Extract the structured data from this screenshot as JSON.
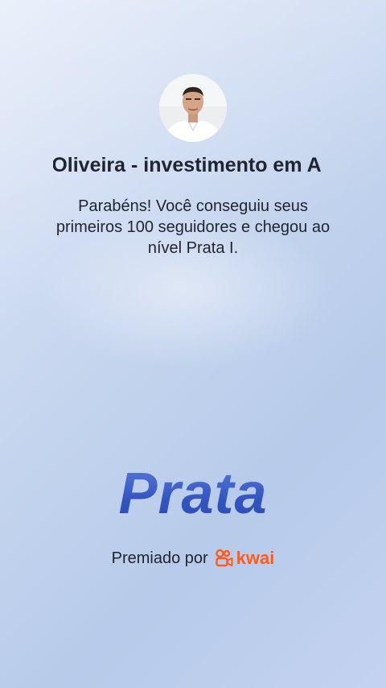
{
  "profile": {
    "name": "Oliveira - investimento em A",
    "avatar_icon": "profile-photo"
  },
  "message": "Parabéns! Você conseguiu seus primeiros 100 seguidores e chegou ao nível Prata I.",
  "level": {
    "label": "Prata",
    "color": "#3d5fc7"
  },
  "award": {
    "prefix": "Premiado por",
    "brand": "kwai",
    "brand_color": "#ff5b1a",
    "brand_icon": "kwai-logo-icon"
  }
}
